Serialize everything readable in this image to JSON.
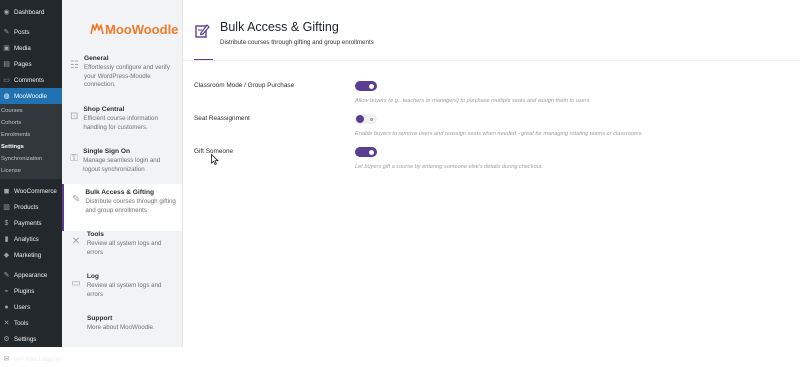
{
  "wp_menu": {
    "top": [
      {
        "label": "Dashboard",
        "icon": "dashboard-icon",
        "glyph": "◉"
      },
      {
        "label": "Posts",
        "icon": "pin-icon",
        "glyph": "✎"
      },
      {
        "label": "Media",
        "icon": "media-icon",
        "glyph": "▣"
      },
      {
        "label": "Pages",
        "icon": "page-icon",
        "glyph": "▤"
      },
      {
        "label": "Comments",
        "icon": "comment-icon",
        "glyph": "▭"
      },
      {
        "label": "MooWoodle",
        "icon": "moowoodle-icon",
        "glyph": "◍"
      }
    ],
    "submenu": [
      "Courses",
      "Cohorts",
      "Enrolments",
      "Settings",
      "Synchronization",
      "License"
    ],
    "bottom": [
      {
        "label": "WooCommerce",
        "icon": "woo-icon",
        "glyph": "◼"
      },
      {
        "label": "Products",
        "icon": "products-icon",
        "glyph": "▥"
      },
      {
        "label": "Payments",
        "icon": "payments-icon",
        "glyph": "$"
      },
      {
        "label": "Analytics",
        "icon": "analytics-icon",
        "glyph": "▮"
      },
      {
        "label": "Marketing",
        "icon": "marketing-icon",
        "glyph": "◆"
      },
      {
        "label": "Appearance",
        "icon": "brush-icon",
        "glyph": "✎"
      },
      {
        "label": "Plugins",
        "icon": "plugins-icon",
        "glyph": "⌁"
      },
      {
        "label": "Users",
        "icon": "users-icon",
        "glyph": "●"
      },
      {
        "label": "Tools",
        "icon": "tools-icon",
        "glyph": "✕"
      },
      {
        "label": "Settings",
        "icon": "settings-icon",
        "glyph": "⚙"
      },
      {
        "label": "WP Mail Logging",
        "icon": "mail-icon",
        "glyph": "✉"
      }
    ]
  },
  "plugin_nav": {
    "logo_text": "MooWoodle",
    "items": [
      {
        "title": "General",
        "desc": "Effortlessly configure and verify your WordPress-Moodle connection.",
        "icon": "sliders-icon",
        "glyph": "☷"
      },
      {
        "title": "Shop Central",
        "desc": "Efficient course information handling for customers.",
        "icon": "cart-icon",
        "glyph": "⊡"
      },
      {
        "title": "Single Sign On",
        "desc": "Manage seamless login and logout synchronization",
        "icon": "key-icon",
        "glyph": "⚿"
      },
      {
        "title": "Bulk Access & Gifting",
        "desc": "Distribute courses through gifting and group enrollments",
        "icon": "edit-icon",
        "glyph": "✎"
      },
      {
        "title": "Tools",
        "desc": "Review all system logs and errors",
        "icon": "tools-icon",
        "glyph": "✕"
      },
      {
        "title": "Log",
        "desc": "Review all system logs and errors",
        "icon": "card-icon",
        "glyph": "▭"
      },
      {
        "title": "Support",
        "desc": "More about MooWoodle.",
        "icon": "support-icon",
        "glyph": ""
      }
    ]
  },
  "page": {
    "title": "Bulk Access & Gifting",
    "subtitle": "Distribute courses through gifting and group enrollments"
  },
  "settings": [
    {
      "label": "Classroom Mode / Group Purchase",
      "enabled": true,
      "desc": "Allow buyers (e.g., teachers or managers) to purchase multiple seats and assign them to users."
    },
    {
      "label": "Seat Reassignment",
      "enabled": false,
      "desc": "Enable buyers to remove users and reassign seats when needed - great for managing rotating teams or classrooms."
    },
    {
      "label": "Gift Someone",
      "enabled": true,
      "desc": "Let buyers gift a course by entering someone else's details during checkout."
    }
  ],
  "colors": {
    "accent": "#5b3e91",
    "wp_active": "#2271b1",
    "logo": "#f07a2c"
  }
}
